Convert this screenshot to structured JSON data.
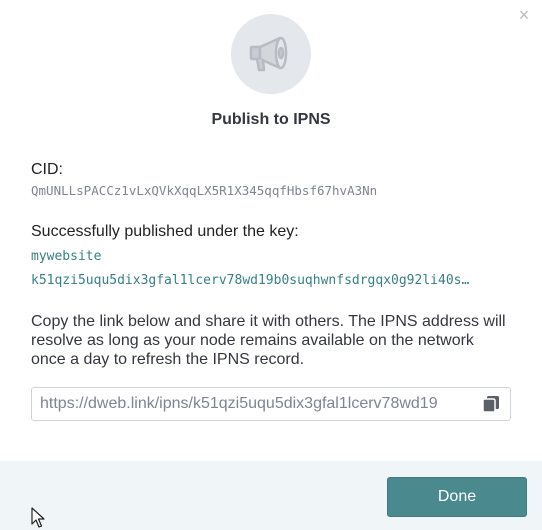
{
  "dialog": {
    "title": "Publish to IPNS",
    "close_glyph": "×",
    "icon": "megaphone-icon"
  },
  "cid": {
    "label": "CID:",
    "value": "QmUNLLsPACCz1vLxQVkXqqLX5R1X345qqfHbsf67hvA3Nn"
  },
  "key": {
    "label": "Successfully published under the key:",
    "name": "mywebsite",
    "id": "k51qzi5uqu5dix3gfal1lcerv78wd19b0suqhwnfsdrgqx0g92li40s…"
  },
  "description": "Copy the link below and share it with others. The IPNS address will resolve as long as your node remains available on the network once a day to refresh the IPNS record.",
  "link": {
    "value": "https://dweb.link/ipns/k51qzi5uqu5dix3gfal1lcerv78wd19",
    "copy_icon": "copy-icon"
  },
  "footer": {
    "done_label": "Done"
  },
  "colors": {
    "accent": "#4a8a8e",
    "key_text": "#378085",
    "footer_bg": "#f0f5f7",
    "icon_circle": "#e4e8ec"
  }
}
